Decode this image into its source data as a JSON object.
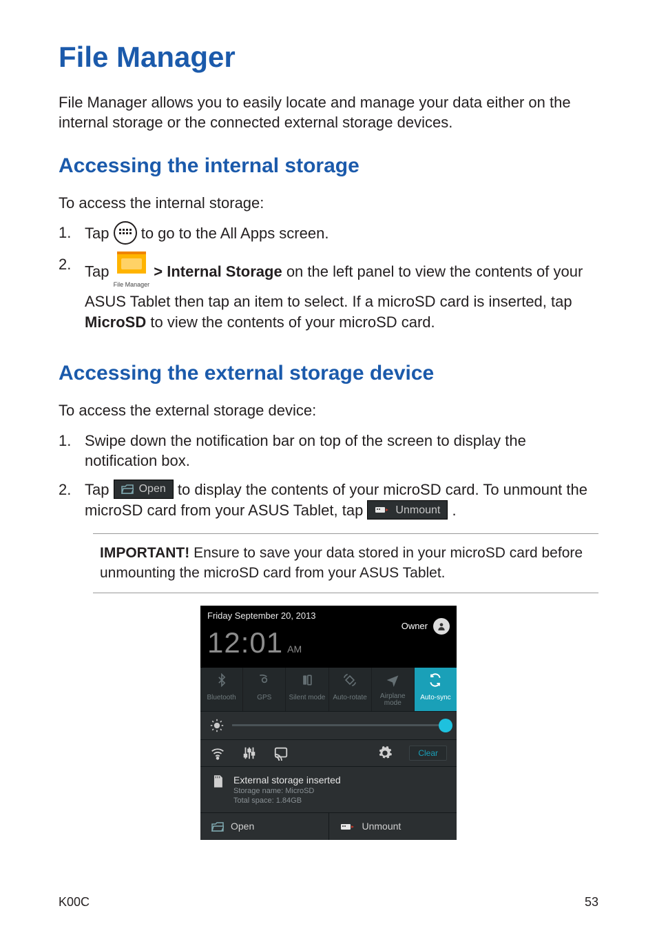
{
  "title": "File Manager",
  "intro": "File Manager allows you to easily locate and manage your data either on the internal storage or the connected external storage devices.",
  "section1": {
    "heading": "Accessing the internal storage",
    "lead": "To access the internal storage:",
    "step1_pre": "Tap ",
    "step1_post": " to go to the All Apps screen.",
    "step2_pre": "Tap ",
    "step2_gt": " > ",
    "step2_strong": "Internal Storage",
    "step2_post": " on the left panel to view the contents of your ASUS Tablet then tap an item to select. If a microSD card is inserted, tap ",
    "step2_strong2": "MicroSD",
    "step2_post2": " to view the contents of your microSD card.",
    "file_manager_label": "File Manager"
  },
  "section2": {
    "heading": "Accessing the external storage device",
    "lead": "To access the external storage device:",
    "step1": "Swipe down the notification bar on top of the screen to display the notification box.",
    "step2_pre": "Tap ",
    "open_label": "Open",
    "step2_mid": " to display the contents of your microSD card. To unmount the microSD card from your ASUS Tablet, tap ",
    "unmount_label": "Unmount",
    "step2_post": "."
  },
  "important": {
    "label": "IMPORTANT!",
    "text": "  Ensure to save your data stored in your microSD card before unmounting the microSD card from your ASUS Tablet."
  },
  "panel": {
    "date": "Friday September 20, 2013",
    "time": "12:01",
    "ampm": "AM",
    "owner": "Owner",
    "toggles": {
      "bt": "Bluetooth",
      "gps": "GPS",
      "silent": "Silent mode",
      "rotate": "Auto-rotate",
      "airplane1": "Airplane",
      "airplane2": "mode",
      "sync": "Auto-sync"
    },
    "clear": "Clear",
    "notif_title": "External storage inserted",
    "notif_sub1": "Storage name: MicroSD",
    "notif_sub2": "Total space: 1.84GB",
    "act_open": "Open",
    "act_unmount": "Unmount"
  },
  "footer": {
    "left": "K00C",
    "right": "53"
  }
}
